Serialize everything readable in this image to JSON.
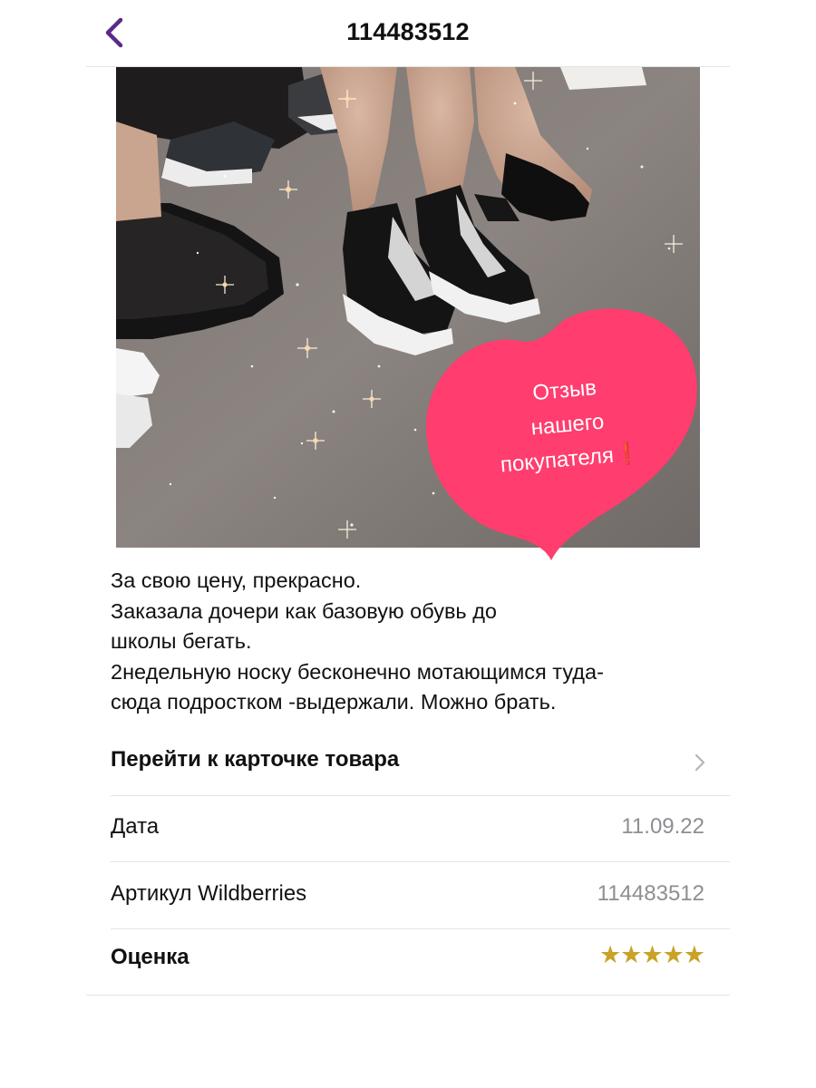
{
  "header": {
    "title": "114483512"
  },
  "photo": {
    "sticker_text": "Отзыв\nнашего\nпокупателя❗"
  },
  "review": {
    "text": "За свою цену, прекрасно.\nЗаказала дочери как базовую обувь до\nшколы бегать.\n 2недельную носку бесконечно мотающимся туда-\nсюда подростком -выдержали. Можно брать."
  },
  "rows": {
    "product_link_label": "Перейти к карточке товара",
    "date_label": "Дата",
    "date_value": "11.09.22",
    "article_label": "Артикул Wildberries",
    "article_value": "114483512",
    "rating_label": "Оценка",
    "rating_stars": "★★★★★"
  },
  "colors": {
    "accent": "#5b2a86",
    "heart": "#ff3d6e",
    "star": "#c9a227",
    "secondary_text": "#8e8e93"
  },
  "icons": {
    "back": "chevron-left-icon",
    "disclosure": "chevron-right-icon",
    "rating": "star-icon"
  }
}
